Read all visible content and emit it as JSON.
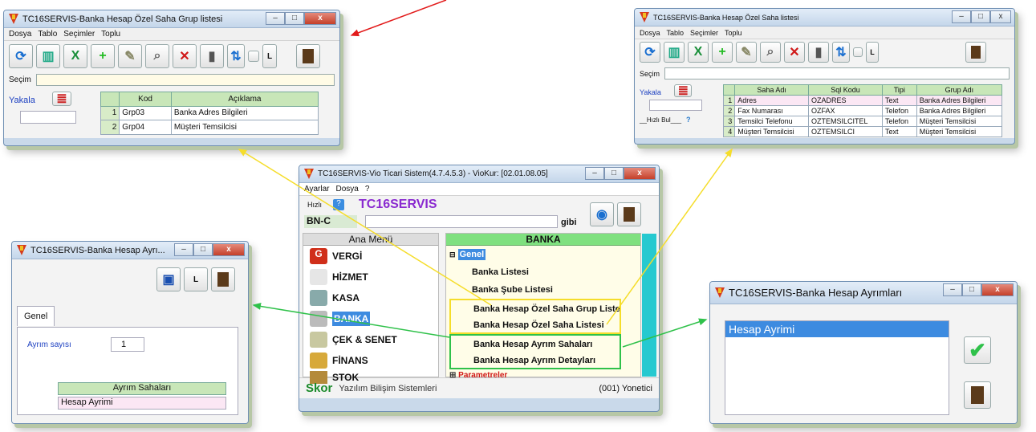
{
  "grup_window": {
    "title": "TC16SERVIS-Banka Hesap Özel Saha Grup listesi",
    "menu": [
      "Dosya",
      "Tablo",
      "Seçimler",
      "Toplu"
    ],
    "secim_label": "Seçim",
    "yakala": "Yakala",
    "columns": [
      "Kod",
      "Açıklama"
    ],
    "rows": [
      [
        "1",
        "Grp03",
        "Banka Adres Bilgileri"
      ],
      [
        "2",
        "Grp04",
        "Müşteri Temsilcisi"
      ]
    ]
  },
  "saha_window": {
    "title": "TC16SERVIS-Banka Hesap Özel Saha listesi",
    "menu": [
      "Dosya",
      "Tablo",
      "Seçimler",
      "Toplu"
    ],
    "secim_label": "Seçim",
    "yakala": "Yakala",
    "hizli_bul": "__Hızlı Bul___",
    "columns": [
      "Saha Adı",
      "Sql Kodu",
      "Tipi",
      "Grup Adı"
    ],
    "rows": [
      [
        "1",
        "Adres",
        "OZADRES",
        "Text",
        "Banka Adres Bilgileri"
      ],
      [
        "2",
        "Fax Numarası",
        "OZFAX",
        "Telefon",
        "Banka Adres Bilgileri"
      ],
      [
        "3",
        "Temsilci Telefonu",
        "OZTEMSILCITEL",
        "Telefon",
        "Müşteri Temsilcisi"
      ],
      [
        "4",
        "Müşteri Temsilcisi",
        "OZTEMSILCI",
        "Text",
        "Müşteri Temsilcisi"
      ]
    ]
  },
  "main_window": {
    "title": "TC16SERVIS-Vio Ticari Sistem(4.7.4.5.3) - VioKur: [02.01.08.05]",
    "menu": [
      "Ayarlar",
      "Dosya",
      "?"
    ],
    "hizli": "Hızlı",
    "company": "TC16SERVIS",
    "code": "BN-C",
    "gibi": "gibi",
    "ana_menu": "Ana Menü",
    "banka_header": "BANKA",
    "modules": [
      "VERGİ",
      "HİZMET",
      "KASA",
      "BANKA",
      "ÇEK & SENET",
      "FİNANS",
      "STOK"
    ],
    "tree_root": "Genel",
    "tree_items": [
      "Banka Listesi",
      "Banka Şube Listesi",
      "Banka Hesap Özel Saha Grup Liste",
      "Banka Hesap Özel Saha Listesi",
      "Banka Hesap Ayrım Sahaları",
      "Banka Hesap Ayrım Detayları"
    ],
    "tree_param": "Parametreler",
    "brand": "Skor",
    "brand_sub": "Yazılım Bilişim Sistemleri",
    "user": "(001) Yonetici"
  },
  "ayrim_window": {
    "title": "TC16SERVIS-Banka Hesap Ayrı...",
    "tab": "Genel",
    "ayrim_sayisi_label": "Ayrım sayısı",
    "ayrim_sayisi": "1",
    "list_header": "Ayrım Sahaları",
    "list_item": "Hesap Ayrimi"
  },
  "ayrimlari_window": {
    "title": "TC16SERVIS-Banka Hesap Ayrımları",
    "item": "Hesap Ayrimi"
  },
  "colors": {
    "yellow": "#f5dd2a",
    "green": "#2fc14a",
    "red": "#e21b1b"
  }
}
